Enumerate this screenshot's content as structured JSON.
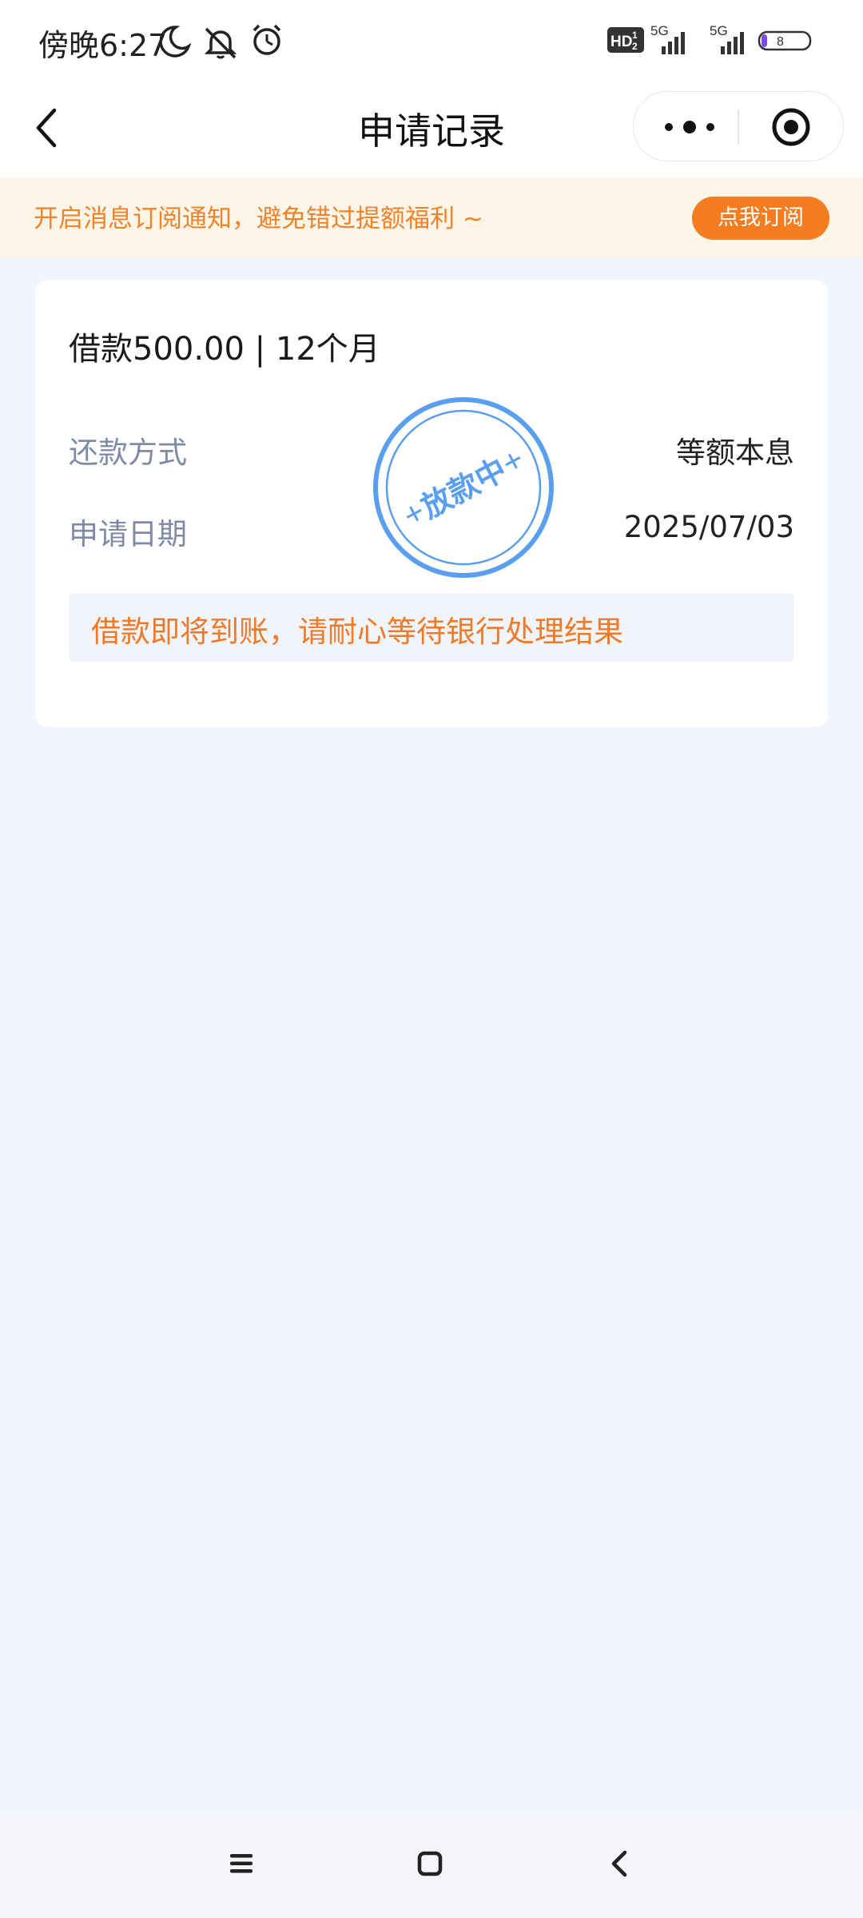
{
  "status_bar": {
    "time": "傍晚6:27",
    "icons": [
      "moon-icon",
      "mute-icon",
      "alarm-icon",
      "hd-icon",
      "signal-5g-icon",
      "signal-5g-icon",
      "battery-icon"
    ],
    "hd_label": "HD",
    "net_label_1": "5G",
    "net_label_2": "5G",
    "battery_level": "8"
  },
  "nav": {
    "title": "申请记录",
    "back_icon": "chevron-left-icon",
    "more_icon": "more-dots-icon",
    "close_icon": "target-icon"
  },
  "banner": {
    "text": "开启消息订阅通知，避免错过提额福利 ~",
    "button_label": "点我订阅"
  },
  "record": {
    "title": "借款500.00 | 12个月",
    "repayment_label": "还款方式",
    "repayment_value": "等额本息",
    "date_label": "申请日期",
    "date_value": "2025/07/03",
    "stamp_text": "放款中",
    "notice": "借款即将到账，请耐心等待银行处理结果"
  },
  "colors": {
    "accent_orange": "#f47d22",
    "stamp_blue": "#5a9ef0",
    "background": "#f1f5fd"
  },
  "system_nav": {
    "icons": [
      "menu-icon",
      "home-icon",
      "back-icon"
    ]
  }
}
